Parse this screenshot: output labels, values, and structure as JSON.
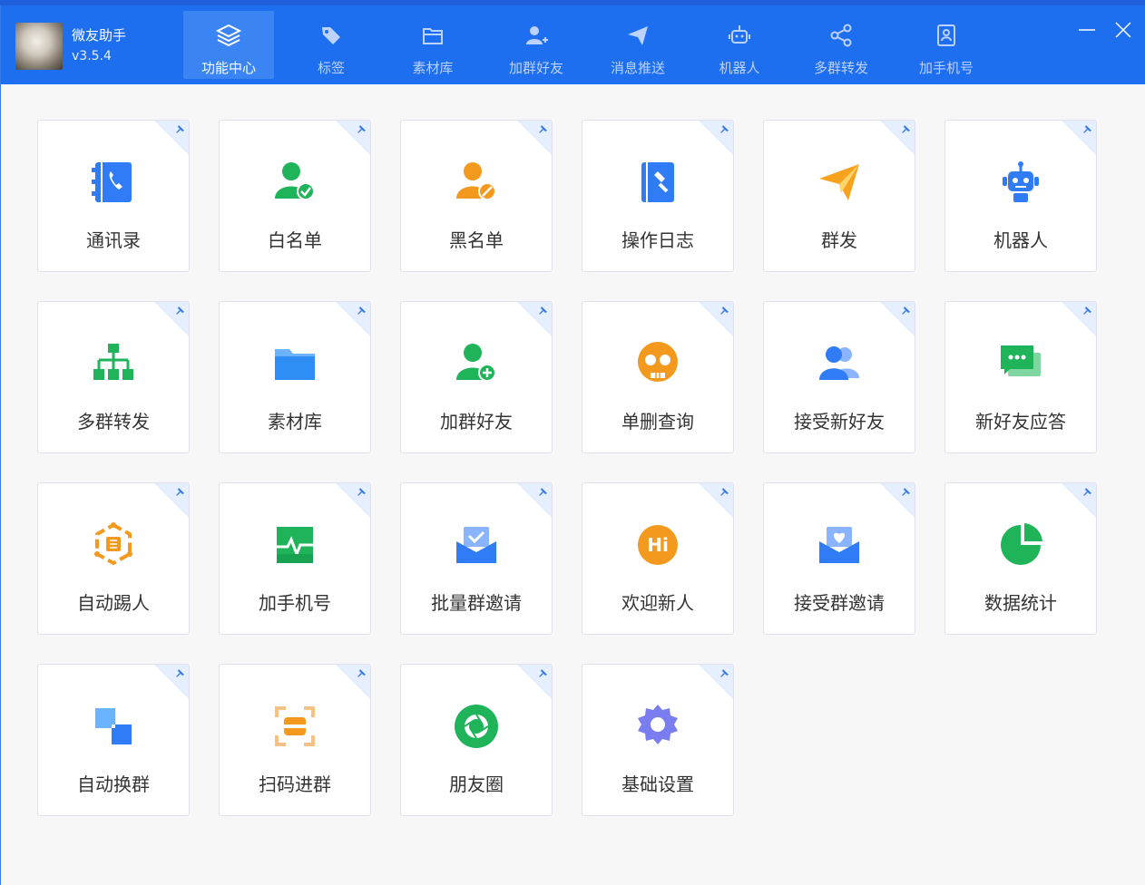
{
  "app": {
    "name": "微友助手",
    "version": "v3.5.4"
  },
  "nav": {
    "tabs": [
      {
        "label": "功能中心",
        "icon": "layers-icon",
        "active": true
      },
      {
        "label": "标签",
        "icon": "tag-icon"
      },
      {
        "label": "素材库",
        "icon": "folder-icon"
      },
      {
        "label": "加群好友",
        "icon": "add-user-icon"
      },
      {
        "label": "消息推送",
        "icon": "send-icon"
      },
      {
        "label": "机器人",
        "icon": "robot-icon"
      },
      {
        "label": "多群转发",
        "icon": "share-icon"
      },
      {
        "label": "加手机号",
        "icon": "contact-card-icon"
      }
    ]
  },
  "cards": [
    {
      "label": "通讯录",
      "icon": "address-book-icon",
      "color": "#2f7cf6"
    },
    {
      "label": "白名单",
      "icon": "user-check-icon",
      "color": "#1fb45a"
    },
    {
      "label": "黑名单",
      "icon": "user-block-icon",
      "color": "#f39a1e"
    },
    {
      "label": "操作日志",
      "icon": "log-book-icon",
      "color": "#2f7cf6"
    },
    {
      "label": "群发",
      "icon": "paper-plane-icon",
      "color": "#f7a21c"
    },
    {
      "label": "机器人",
      "icon": "robot-icon",
      "color": "#2f7cf6"
    },
    {
      "label": "多群转发",
      "icon": "org-chart-icon",
      "color": "#1fb45a"
    },
    {
      "label": "素材库",
      "icon": "folder-icon",
      "color": "#2f8df6"
    },
    {
      "label": "加群好友",
      "icon": "user-plus-icon",
      "color": "#1fb45a"
    },
    {
      "label": "单删查询",
      "icon": "skull-icon",
      "color": "#f39a1e"
    },
    {
      "label": "接受新好友",
      "icon": "users-icon",
      "color": "#2f7cf6"
    },
    {
      "label": "新好友应答",
      "icon": "chat-bubble-icon",
      "color": "#1fb45a"
    },
    {
      "label": "自动踢人",
      "icon": "kick-hexagon-icon",
      "color": "#f39a1e"
    },
    {
      "label": "加手机号",
      "icon": "phone-pulse-icon",
      "color": "#1fb45a"
    },
    {
      "label": "批量群邀请",
      "icon": "envelope-check-icon",
      "color": "#2f7cf6"
    },
    {
      "label": "欢迎新人",
      "icon": "hi-badge-icon",
      "color": "#f39a1e",
      "text": "Hi"
    },
    {
      "label": "接受群邀请",
      "icon": "envelope-heart-icon",
      "color": "#2f7cf6"
    },
    {
      "label": "数据统计",
      "icon": "pie-chart-icon",
      "color": "#1fb45a"
    },
    {
      "label": "自动换群",
      "icon": "swap-squares-icon",
      "color": "#2f7cf6"
    },
    {
      "label": "扫码进群",
      "icon": "scan-icon",
      "color": "#f39a1e"
    },
    {
      "label": "朋友圈",
      "icon": "aperture-icon",
      "color": "#1fb45a"
    },
    {
      "label": "基础设置",
      "icon": "gear-icon",
      "color": "#7a7df0"
    }
  ],
  "colors": {
    "titlebar": "#1e6ef0",
    "accent": "#2f7cf6",
    "pin": "#3a7ae8"
  }
}
